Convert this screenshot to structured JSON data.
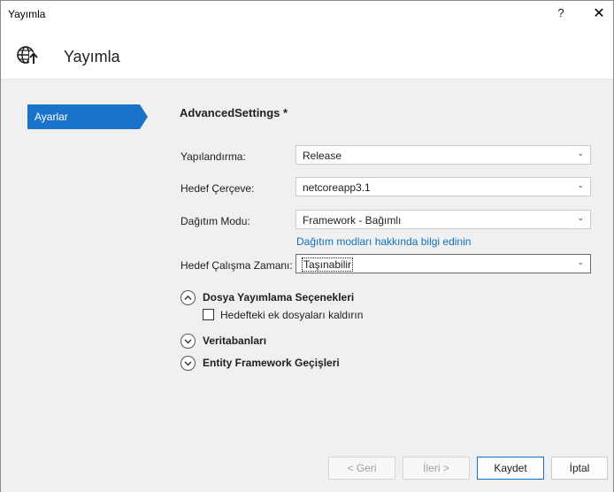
{
  "window": {
    "title": "Yayımla",
    "help_glyph": "?",
    "close_glyph": "✕"
  },
  "header": {
    "title": "Yayımla",
    "icon": "globe-publish-icon"
  },
  "sidebar": {
    "items": [
      {
        "label": "Ayarlar",
        "selected": true
      }
    ]
  },
  "main": {
    "section_title": "AdvancedSettings *",
    "fields": [
      {
        "label": "Yapılandırma:",
        "value": "Release"
      },
      {
        "label": "Hedef Çerçeve:",
        "value": "netcoreapp3.1"
      },
      {
        "label": "Dağıtım Modu:",
        "value": "Framework - Bağımlı"
      },
      {
        "label": "Hedef Çalışma Zamanı:",
        "value": "Taşınabilir"
      }
    ],
    "deploy_mode_link": "Dağıtım modları hakkında bilgi edinin",
    "groups": [
      {
        "label": "Dosya Yayımlama Seçenekleri",
        "expanded": true
      },
      {
        "label": "Veritabanları",
        "expanded": false
      },
      {
        "label": "Entity Framework Geçişleri",
        "expanded": false
      }
    ],
    "checkbox": {
      "label": "Hedefteki ek dosyaları kaldırın",
      "checked": false
    }
  },
  "footer": {
    "back_label": "< Geri",
    "next_label": "İleri >",
    "save_label": "Kaydet",
    "cancel_label": "İptal"
  },
  "colors": {
    "accent": "#1a73c8",
    "link": "#0e70c0",
    "body_bg": "#f0f0f0"
  }
}
